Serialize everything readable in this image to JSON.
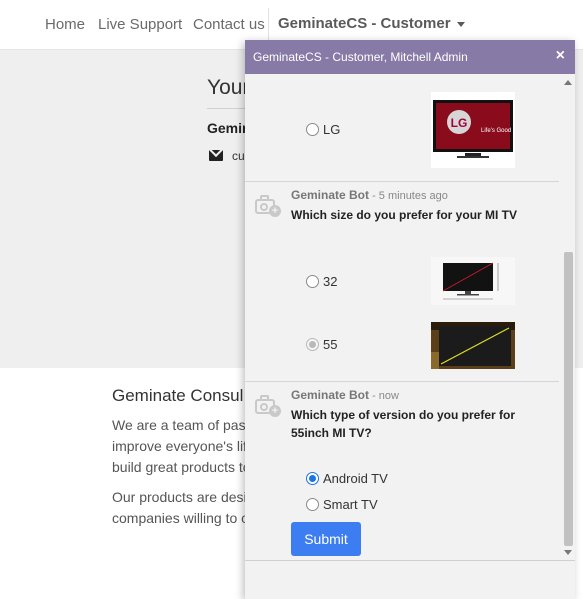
{
  "nav": {
    "home": "Home",
    "live_support": "Live Support",
    "contact": "Contact us",
    "account": "GeminateCS - Customer"
  },
  "page": {
    "heading": "Your",
    "company": "Gemin",
    "email": "cu",
    "about_title": "Geminate Consul",
    "about_p1": "We are a team of pas\nimprove everyone's lif\nbuild great products to",
    "about_p2": "Our products are desi\ncompanies willing to o"
  },
  "chat": {
    "title": "GeminateCS - Customer, Mitchell Admin",
    "close": "×",
    "tv_brand_option": "LG",
    "tv_brand_logo_text": "LG",
    "tv_brand_tagline": "Life's Good",
    "messages": [
      {
        "author": "Geminate Bot",
        "time": " - 5 minutes ago",
        "text": "Which size do you prefer for your MI TV"
      },
      {
        "author": "Geminate Bot",
        "time": " - now",
        "text": "Which type of version do you prefer for 55inch MI TV?"
      }
    ],
    "size_options": [
      {
        "label": "32",
        "selected": false
      },
      {
        "label": "55",
        "selected": true
      }
    ],
    "version_options": [
      {
        "label": "Android TV",
        "selected": true
      },
      {
        "label": "Smart TV",
        "selected": false
      }
    ],
    "submit": "Submit"
  },
  "colors": {
    "chat_header": "#877aa6",
    "submit_button": "#3d7df2",
    "page_band": "#efefef"
  }
}
